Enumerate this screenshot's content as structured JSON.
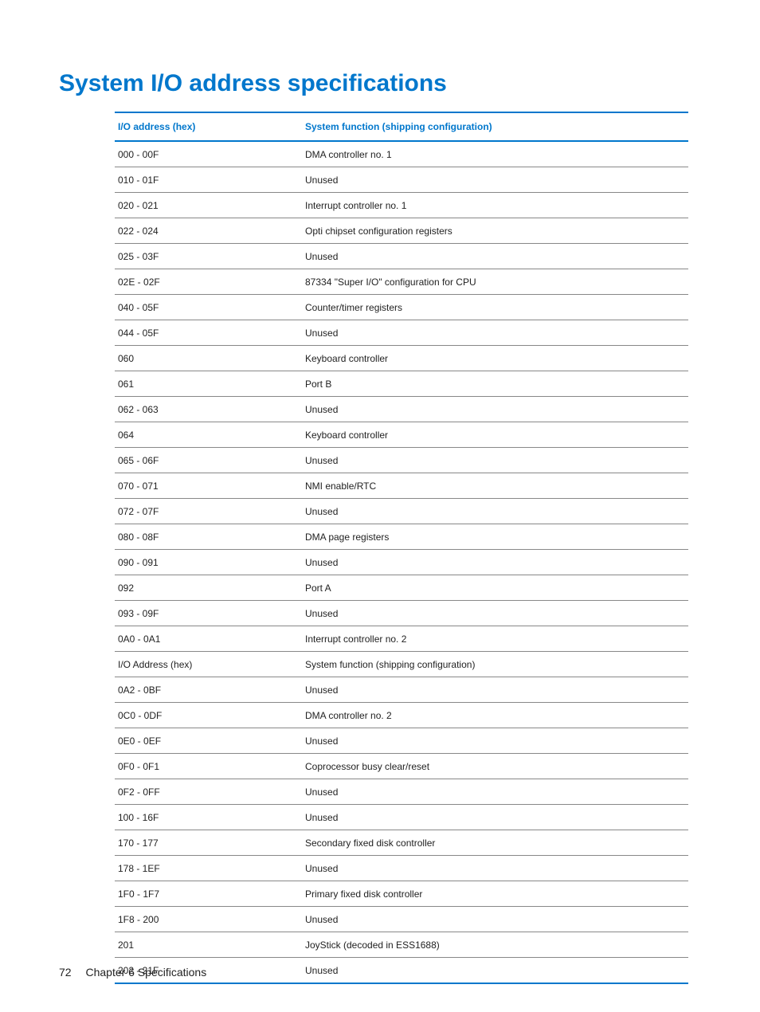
{
  "title": "System I/O address specifications",
  "table": {
    "headers": [
      "I/O address (hex)",
      "System function (shipping configuration)"
    ],
    "rows": [
      [
        "000 - 00F",
        "DMA controller no. 1"
      ],
      [
        "010 - 01F",
        "Unused"
      ],
      [
        "020 - 021",
        "Interrupt controller no. 1"
      ],
      [
        "022 - 024",
        "Opti chipset configuration registers"
      ],
      [
        "025 - 03F",
        "Unused"
      ],
      [
        "02E - 02F",
        "87334 \"Super I/O\" configuration for CPU"
      ],
      [
        "040 - 05F",
        "Counter/timer registers"
      ],
      [
        "044 - 05F",
        "Unused"
      ],
      [
        "060",
        "Keyboard controller"
      ],
      [
        "061",
        "Port B"
      ],
      [
        "062 - 063",
        "Unused"
      ],
      [
        "064",
        "Keyboard controller"
      ],
      [
        "065 - 06F",
        "Unused"
      ],
      [
        "070 - 071",
        "NMI enable/RTC"
      ],
      [
        "072 - 07F",
        "Unused"
      ],
      [
        "080 - 08F",
        "DMA page registers"
      ],
      [
        "090 - 091",
        "Unused"
      ],
      [
        "092",
        "Port A"
      ],
      [
        "093 - 09F",
        "Unused"
      ],
      [
        "0A0 - 0A1",
        "Interrupt controller no. 2"
      ],
      [
        "I/O Address (hex)",
        "System function (shipping configuration)"
      ],
      [
        "0A2 - 0BF",
        "Unused"
      ],
      [
        "0C0 - 0DF",
        "DMA controller no. 2"
      ],
      [
        "0E0 - 0EF",
        "Unused"
      ],
      [
        "0F0 - 0F1",
        "Coprocessor busy clear/reset"
      ],
      [
        "0F2 - 0FF",
        "Unused"
      ],
      [
        "100 - 16F",
        "Unused"
      ],
      [
        "170 - 177",
        "Secondary fixed disk controller"
      ],
      [
        "178 - 1EF",
        "Unused"
      ],
      [
        "1F0 - 1F7",
        "Primary fixed disk controller"
      ],
      [
        "1F8 - 200",
        "Unused"
      ],
      [
        "201",
        "JoyStick (decoded in ESS1688)"
      ],
      [
        "202 - 21F",
        "Unused"
      ]
    ]
  },
  "footer": {
    "page": "72",
    "chapter": "Chapter 6   Specifications"
  }
}
